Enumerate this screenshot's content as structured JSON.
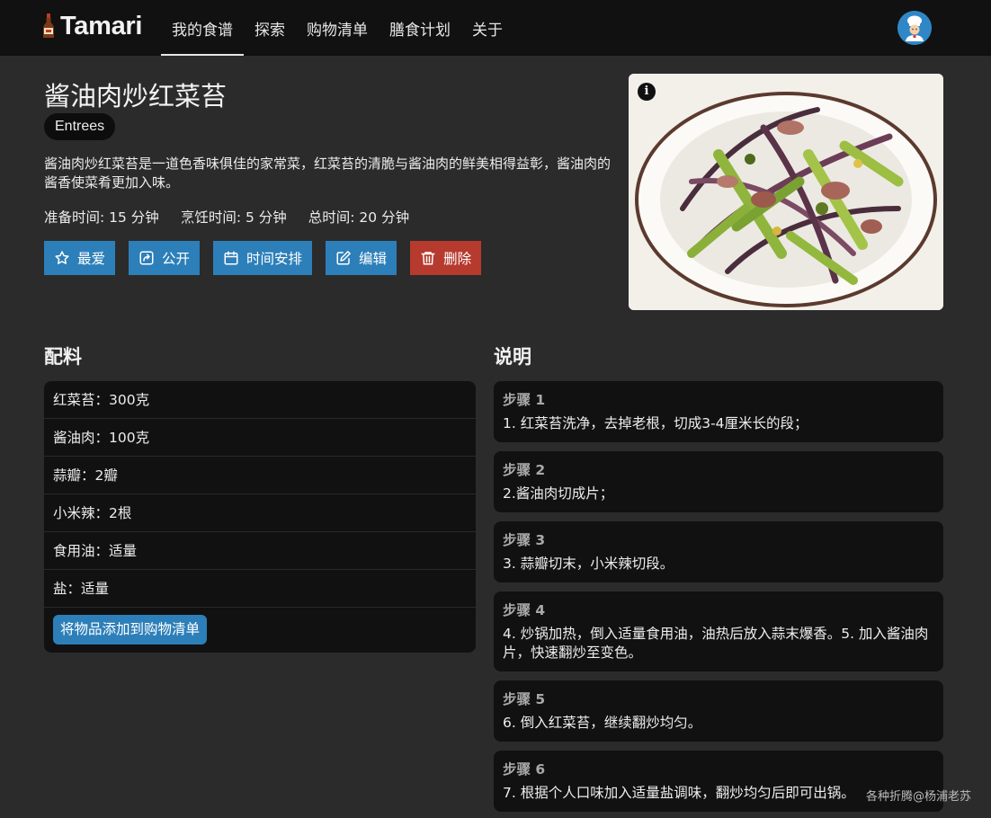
{
  "nav": {
    "brand": "Tamari",
    "items": [
      {
        "label": "我的食谱",
        "active": true
      },
      {
        "label": "探索",
        "active": false
      },
      {
        "label": "购物清单",
        "active": false
      },
      {
        "label": "膳食计划",
        "active": false
      },
      {
        "label": "关于",
        "active": false
      }
    ]
  },
  "recipe": {
    "title": "酱油肉炒红菜苔",
    "category": "Entrees",
    "description": "酱油肉炒红菜苔是一道色香味俱佳的家常菜，红菜苔的清脆与酱油肉的鲜美相得益彰，酱油肉的酱香使菜肴更加入味。",
    "prep_time": "准备时间: 15 分钟",
    "cook_time": "烹饪时间: 5 分钟",
    "total_time": "总时间: 20 分钟"
  },
  "actions": {
    "favorite": "最爱",
    "share": "公开",
    "schedule": "时间安排",
    "edit": "编辑",
    "delete": "删除"
  },
  "ingredients": {
    "heading": "配料",
    "items": [
      "红菜苔：300克",
      "酱油肉：100克",
      "蒜瓣：2瓣",
      "小米辣：2根",
      "食用油：适量",
      "盐：适量"
    ],
    "add_button": "将物品添加到购物清单"
  },
  "instructions": {
    "heading": "说明",
    "steps": [
      {
        "label": "步骤 1",
        "text": "1. 红菜苔洗净，去掉老根，切成3-4厘米长的段；"
      },
      {
        "label": "步骤 2",
        "text": "2.酱油肉切成片；"
      },
      {
        "label": "步骤 3",
        "text": "3. 蒜瓣切末，小米辣切段。"
      },
      {
        "label": "步骤 4",
        "text": "4. 炒锅加热，倒入适量食用油，油热后放入蒜末爆香。5. 加入酱油肉片，快速翻炒至变色。"
      },
      {
        "label": "步骤 5",
        "text": "6. 倒入红菜苔，继续翻炒均匀。"
      },
      {
        "label": "步骤 6",
        "text": "7. 根据个人口味加入适量盐调味，翻炒均匀后即可出锅。"
      }
    ]
  },
  "watermark": "各种折腾@杨浦老苏",
  "colors": {
    "navbar": "#111111",
    "background": "#2b2b2b",
    "card": "#111111",
    "primary_button": "#2d7fb9",
    "danger_button": "#b73a2e"
  },
  "icons": {
    "favorite": "star-icon",
    "share": "share-icon",
    "schedule": "calendar-icon",
    "edit": "edit-icon",
    "delete": "trash-icon",
    "photo_info": "info-icon"
  }
}
